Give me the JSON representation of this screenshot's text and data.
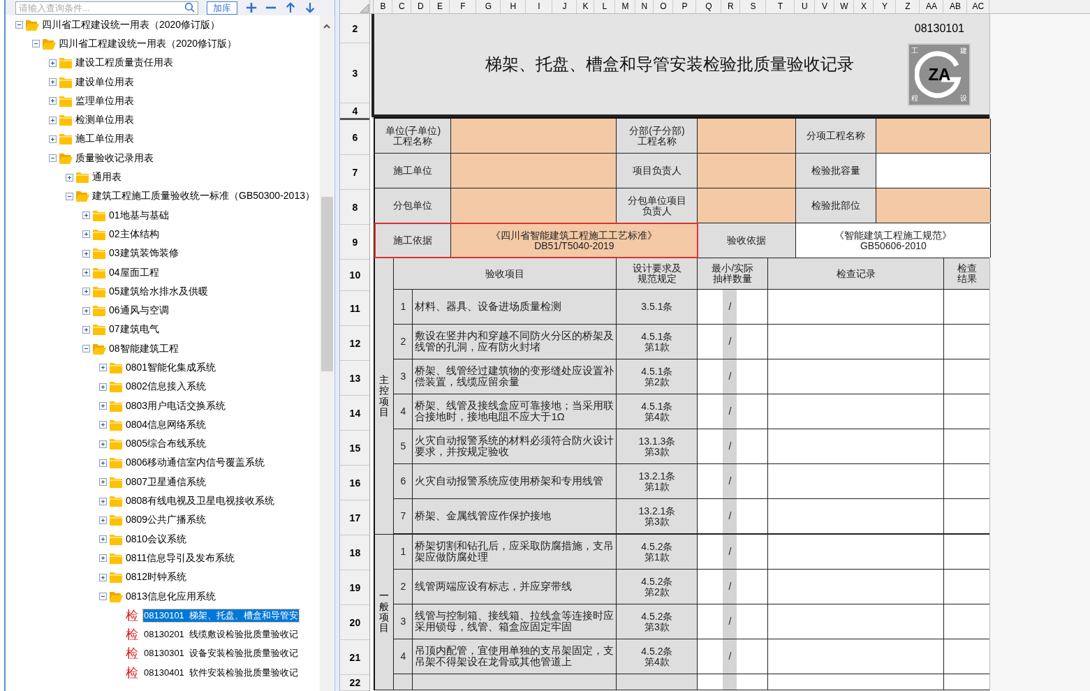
{
  "toolbar": {
    "search": {
      "placeholder": "请输入查询条件..."
    },
    "add_button": "加库"
  },
  "tree": [
    {
      "label": "四川省工程建设统一用表（2020修订版）",
      "kind": "folder",
      "expanded": true,
      "selected": false,
      "children": [
        {
          "label": "四川省工程建设统一用表（2020修订版）",
          "kind": "folder",
          "expanded": true,
          "selected": false,
          "children": [
            {
              "label": "建设工程质量责任用表",
              "kind": "folder",
              "expanded": false,
              "selected": false
            },
            {
              "label": "建设单位用表",
              "kind": "folder",
              "expanded": false,
              "selected": false
            },
            {
              "label": "监理单位用表",
              "kind": "folder",
              "expanded": false,
              "selected": false
            },
            {
              "label": "检测单位用表",
              "kind": "folder",
              "expanded": false,
              "selected": false
            },
            {
              "label": "施工单位用表",
              "kind": "folder",
              "expanded": false,
              "selected": false
            },
            {
              "label": "质量验收记录用表",
              "kind": "folder",
              "expanded": true,
              "selected": false,
              "children": [
                {
                  "label": "通用表",
                  "kind": "folder",
                  "expanded": false,
                  "selected": false
                },
                {
                  "label": "建筑工程施工质量验收统一标准（GB50300-2013）",
                  "kind": "folder",
                  "expanded": true,
                  "selected": false,
                  "children": [
                    {
                      "label": "01地基与基础",
                      "kind": "folder",
                      "expanded": false,
                      "selected": false
                    },
                    {
                      "label": "02主体结构",
                      "kind": "folder",
                      "expanded": false,
                      "selected": false
                    },
                    {
                      "label": "03建筑装饰装修",
                      "kind": "folder",
                      "expanded": false,
                      "selected": false
                    },
                    {
                      "label": "04屋面工程",
                      "kind": "folder",
                      "expanded": false,
                      "selected": false
                    },
                    {
                      "label": "05建筑给水排水及供暖",
                      "kind": "folder",
                      "expanded": false,
                      "selected": false
                    },
                    {
                      "label": "06通风与空调",
                      "kind": "folder",
                      "expanded": false,
                      "selected": false
                    },
                    {
                      "label": "07建筑电气",
                      "kind": "folder",
                      "expanded": false,
                      "selected": false
                    },
                    {
                      "label": "08智能建筑工程",
                      "kind": "folder",
                      "expanded": true,
                      "selected": false,
                      "children": [
                        {
                          "label": "0801智能化集成系统",
                          "kind": "folder",
                          "expanded": false,
                          "selected": false
                        },
                        {
                          "label": "0802信息接入系统",
                          "kind": "folder",
                          "expanded": false,
                          "selected": false
                        },
                        {
                          "label": "0803用户电话交换系统",
                          "kind": "folder",
                          "expanded": false,
                          "selected": false
                        },
                        {
                          "label": "0804信息网络系统",
                          "kind": "folder",
                          "expanded": false,
                          "selected": false
                        },
                        {
                          "label": "0805综合布线系统",
                          "kind": "folder",
                          "expanded": false,
                          "selected": false
                        },
                        {
                          "label": "0806移动通信室内信号覆盖系统",
                          "kind": "folder",
                          "expanded": false,
                          "selected": false
                        },
                        {
                          "label": "0807卫星通信系统",
                          "kind": "folder",
                          "expanded": false,
                          "selected": false
                        },
                        {
                          "label": "0808有线电视及卫星电视接收系统",
                          "kind": "folder",
                          "expanded": false,
                          "selected": false
                        },
                        {
                          "label": "0809公共广播系统",
                          "kind": "folder",
                          "expanded": false,
                          "selected": false
                        },
                        {
                          "label": "0810会议系统",
                          "kind": "folder",
                          "expanded": false,
                          "selected": false
                        },
                        {
                          "label": "0811信息导引及发布系统",
                          "kind": "folder",
                          "expanded": false,
                          "selected": false
                        },
                        {
                          "label": "0812时钟系统",
                          "kind": "folder",
                          "expanded": false,
                          "selected": false
                        },
                        {
                          "label": "0813信息化应用系统",
                          "kind": "folder",
                          "expanded": true,
                          "selected": false,
                          "children": [
                            {
                              "label": "08130101  梯架、托盘、槽盒和导管安",
                              "kind": "form",
                              "badge": "检",
                              "selected": true
                            },
                            {
                              "label": "08130201  线缆敷设检验批质量验收记",
                              "kind": "form",
                              "badge": "检",
                              "selected": false
                            },
                            {
                              "label": "08130301  设备安装检验批质量验收记",
                              "kind": "form",
                              "badge": "检",
                              "selected": false
                            },
                            {
                              "label": "08130401  软件安装检验批质量验收记",
                              "kind": "form",
                              "badge": "检",
                              "selected": false
                            }
                          ]
                        }
                      ]
                    }
                  ]
                }
              ]
            }
          ]
        }
      ]
    }
  ],
  "columns": [
    "B",
    "C",
    "D",
    "E",
    "F",
    "G",
    "H",
    "I",
    "J",
    "K",
    "L",
    "M",
    "N",
    "O",
    "P",
    "Q",
    "R",
    "S",
    "T",
    "U",
    "V",
    "W",
    "X",
    "Y",
    "Z",
    "AA",
    "AB",
    "AC"
  ],
  "row_headers": [
    "2",
    "3",
    "4",
    "6",
    "7",
    "8",
    "9",
    "10",
    "11",
    "12",
    "13",
    "14",
    "15",
    "16",
    "17",
    "18",
    "19",
    "20",
    "21",
    "22"
  ],
  "sheet": {
    "code": "08130101",
    "title": "梯架、托盘、槽盒和导管安装检验批质量验收记录",
    "logo": {
      "text": "ZA",
      "corners": [
        "工",
        "建",
        "程",
        "设"
      ]
    },
    "info_rows": [
      {
        "kind": "info",
        "pairs": [
          {
            "label": [
              "单位(子单位)",
              "工程名称"
            ],
            "highlighted": true,
            "outlined": false
          },
          {
            "label": [
              "分部(子分部)",
              "工程名称"
            ],
            "highlighted": true,
            "outlined": false
          },
          {
            "label": [
              "分项工程名称"
            ],
            "highlighted": true,
            "outlined": false
          }
        ]
      },
      {
        "kind": "info",
        "pairs": [
          {
            "label": [
              "施工单位"
            ],
            "highlighted": true,
            "outlined": false
          },
          {
            "label": [
              "项目负责人"
            ],
            "highlighted": true,
            "outlined": false
          },
          {
            "label": [
              "检验批容量"
            ],
            "highlighted": false,
            "outlined": false
          }
        ]
      },
      {
        "kind": "info",
        "pairs": [
          {
            "label": [
              "分包单位"
            ],
            "highlighted": true,
            "outlined": false
          },
          {
            "label": [
              "分包单位项目",
              "负责人"
            ],
            "highlighted": true,
            "outlined": false
          },
          {
            "label": [
              "检验批部位"
            ],
            "highlighted": true,
            "outlined": false
          }
        ]
      },
      {
        "kind": "basis",
        "pairs": [
          {
            "label": [
              "施工依据"
            ],
            "value": [
              "《四川省智能建筑工程施工工艺标准》",
              "DB51/T5040-2019"
            ],
            "highlighted": true,
            "outlined": true
          },
          {
            "label": [
              "验收依据"
            ],
            "value": [
              "《智能建筑工程施工规范》",
              "GB50606-2010"
            ],
            "highlighted": false,
            "outlined": false
          }
        ]
      }
    ],
    "table_header": {
      "item": [
        "验收项目"
      ],
      "spec": [
        "设计要求及",
        "规范规定"
      ],
      "sample": [
        "最小/实际",
        "抽样数量"
      ],
      "record": [
        "检查记录"
      ],
      "result": [
        "检查",
        "结果"
      ]
    },
    "sections": [
      {
        "category": "主控项目",
        "header": true,
        "rows": [
          {
            "kind": "item",
            "no": "1",
            "item": "材料、器具、设备进场质量检测",
            "spec": [
              "3.5.1条"
            ],
            "sample": "/"
          },
          {
            "kind": "item",
            "no": "2",
            "item": "敷设在竖井内和穿越不同防火分区的桥架及线管的孔洞，应有防火封堵",
            "spec": [
              "4.5.1条",
              "第1款"
            ],
            "sample": "/"
          },
          {
            "kind": "item",
            "no": "3",
            "item": "桥架、线管经过建筑物的变形缝处应设置补偿装置，线缆应留余量",
            "spec": [
              "4.5.1条",
              "第2款"
            ],
            "sample": "/"
          },
          {
            "kind": "item",
            "no": "4",
            "item": "桥架、线管及接线盒应可靠接地；当采用联合接地时，接地电阻不应大于1Ω",
            "spec": [
              "4.5.1条",
              "第4款"
            ],
            "sample": "/"
          },
          {
            "kind": "item",
            "no": "5",
            "item": "火灾自动报警系统的材料必须符合防火设计要求，并按规定验收",
            "spec": [
              "13.1.3条",
              "第3款"
            ],
            "sample": "/"
          },
          {
            "kind": "item",
            "no": "6",
            "item": "火灾自动报警系统应使用桥架和专用线管",
            "spec": [
              "13.2.1条",
              "第1款"
            ],
            "sample": "/"
          },
          {
            "kind": "item",
            "no": "7",
            "item": "桥架、金属线管应作保护接地",
            "spec": [
              "13.2.1条",
              "第3款"
            ],
            "sample": "/"
          }
        ]
      },
      {
        "category": "一般项目",
        "header": false,
        "rows": [
          {
            "kind": "item",
            "no": "1",
            "item": "桥架切割和钻孔后，应采取防腐措施，支吊架应做防腐处理",
            "spec": [
              "4.5.2条",
              "第1款"
            ],
            "sample": "/"
          },
          {
            "kind": "item",
            "no": "2",
            "item": "线管两端应设有标志，并应穿带线",
            "spec": [
              "4.5.2条",
              "第2款"
            ],
            "sample": "/"
          },
          {
            "kind": "item",
            "no": "3",
            "item": "线管与控制箱、接线箱、拉线盒等连接时应采用锁母，线管、箱盒应固定牢固",
            "spec": [
              "4.5.2条",
              "第3款"
            ],
            "sample": "/"
          },
          {
            "kind": "item",
            "no": "4",
            "item": "吊顶内配管，宜使用单独的支吊架固定，支吊架不得架设在龙骨或其他管道上",
            "spec": [
              "4.5.2条",
              "第4款"
            ],
            "sample": "/"
          },
          {
            "kind": "partial"
          }
        ]
      }
    ]
  }
}
